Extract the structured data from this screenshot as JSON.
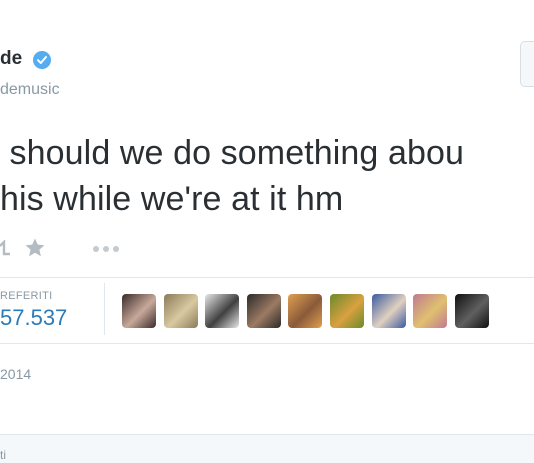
{
  "author": {
    "name": "de",
    "handle": "demusic",
    "verified": true
  },
  "tweet": {
    "line1": " should we do something abou",
    "line2": "his while we're at it hm"
  },
  "actions": {
    "retweet_icon": "retweet-icon",
    "favorite_icon": "star-icon",
    "more_icon": "ellipsis-icon"
  },
  "stats": {
    "label": "REFERITI",
    "count": "57.537"
  },
  "favoriters": [
    {
      "name": "avatar-1",
      "colors": [
        "#3a2a2a",
        "#c8a99a"
      ]
    },
    {
      "name": "avatar-2",
      "colors": [
        "#8a7a5a",
        "#d9c9a0"
      ]
    },
    {
      "name": "avatar-3",
      "colors": [
        "#e8e8e8",
        "#404040"
      ]
    },
    {
      "name": "avatar-4",
      "colors": [
        "#2a2a2a",
        "#9c7a62"
      ]
    },
    {
      "name": "avatar-5",
      "colors": [
        "#e0a050",
        "#8a5a3a"
      ]
    },
    {
      "name": "avatar-6",
      "colors": [
        "#6a8a2a",
        "#d9a040"
      ]
    },
    {
      "name": "avatar-7",
      "colors": [
        "#3a5aa0",
        "#e0d0c0"
      ]
    },
    {
      "name": "avatar-8",
      "colors": [
        "#c07a90",
        "#e0c070"
      ]
    },
    {
      "name": "avatar-9",
      "colors": [
        "#101010",
        "#606060"
      ]
    }
  ],
  "date": "2014",
  "footer": "ti",
  "colors": {
    "link_blue": "#2b7bb9",
    "verified_blue": "#55acee",
    "muted": "#8899a6",
    "divider": "#e1e8ed"
  }
}
